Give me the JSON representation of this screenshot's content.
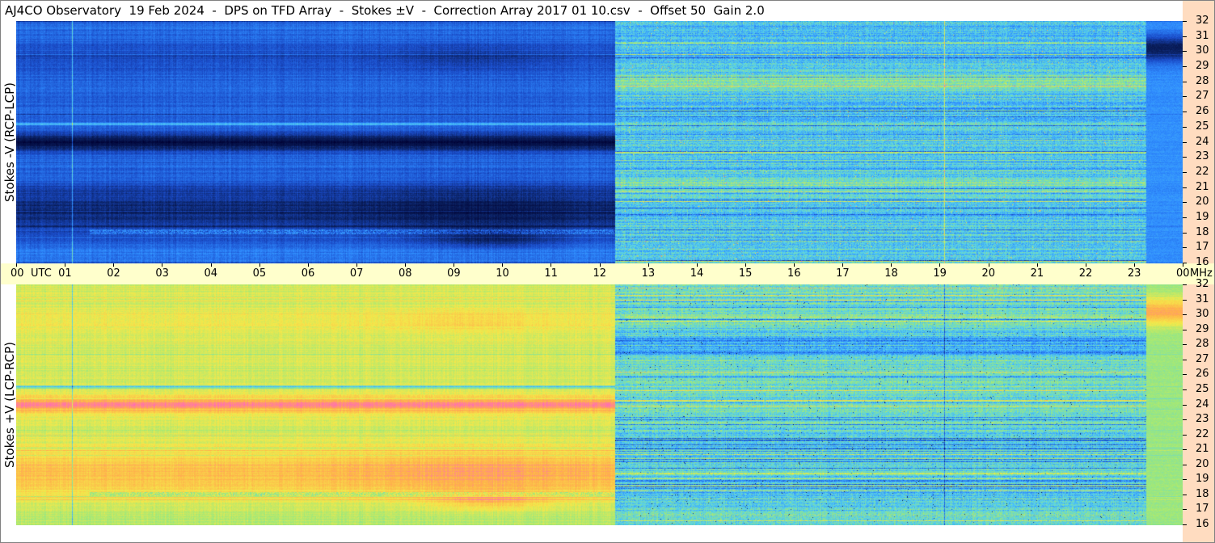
{
  "title": "AJ4CO Observatory  19 Feb 2024  -  DPS on TFD Array  -  Stokes ±V  -  Correction Array 2017 01 10.csv  -  Offset 50  Gain 2.0",
  "chart_data": [
    {
      "type": "heatmap",
      "panel": "top",
      "ylabel": "Stokes -V (RCP-LCP)",
      "xlabel": "UTC",
      "x_unit": "UTC",
      "y_unit": "MHz",
      "xlim": [
        0,
        24
      ],
      "ylim": [
        16,
        32
      ],
      "x_tick_labels": [
        "00",
        "01",
        "02",
        "03",
        "04",
        "05",
        "06",
        "07",
        "08",
        "09",
        "10",
        "11",
        "12",
        "13",
        "14",
        "15",
        "16",
        "17",
        "18",
        "19",
        "20",
        "21",
        "22",
        "23",
        "00"
      ],
      "y_ticks": [
        16,
        17,
        18,
        19,
        20,
        21,
        22,
        23,
        24,
        25,
        26,
        27,
        28,
        29,
        30,
        31,
        32
      ],
      "y_tick_labels": [
        "16",
        "17",
        "18",
        "19",
        "20",
        "21",
        "22",
        "23",
        "24",
        "25",
        "26",
        "27",
        "28",
        "29",
        "30",
        "31",
        "32"
      ],
      "colormap": [
        "#000033",
        "#0a1f5c",
        "#1a4bc8",
        "#2f8cff",
        "#55d0ee",
        "#9ee87a",
        "#f5e84a",
        "#ffb04a",
        "#ff66c0"
      ]
    },
    {
      "type": "heatmap",
      "panel": "bottom",
      "ylabel": "Stokes +V (LCP-RCP)",
      "xlabel": "UTC",
      "x_unit": "UTC",
      "y_unit": "MHz",
      "xlim": [
        0,
        24
      ],
      "ylim": [
        16,
        32
      ],
      "x_tick_labels": [
        "00",
        "01",
        "02",
        "03",
        "04",
        "05",
        "06",
        "07",
        "08",
        "09",
        "10",
        "11",
        "12",
        "13",
        "14",
        "15",
        "16",
        "17",
        "18",
        "19",
        "20",
        "21",
        "22",
        "23",
        "00"
      ],
      "y_ticks": [
        16,
        17,
        18,
        19,
        20,
        21,
        22,
        23,
        24,
        25,
        26,
        27,
        28,
        29,
        30,
        31,
        32
      ],
      "y_tick_labels": [
        "16",
        "17",
        "18",
        "19",
        "20",
        "21",
        "22",
        "23",
        "24",
        "25",
        "26",
        "27",
        "28",
        "29",
        "30",
        "31",
        "32"
      ],
      "colormap": [
        "#000033",
        "#0a1f5c",
        "#1a4bc8",
        "#2f8cff",
        "#55d0ee",
        "#9ee87a",
        "#f5e84a",
        "#ffb04a",
        "#ff66c0"
      ]
    }
  ],
  "axis": {
    "x_unit_label": "UTC",
    "y_unit_label": "MHz"
  }
}
